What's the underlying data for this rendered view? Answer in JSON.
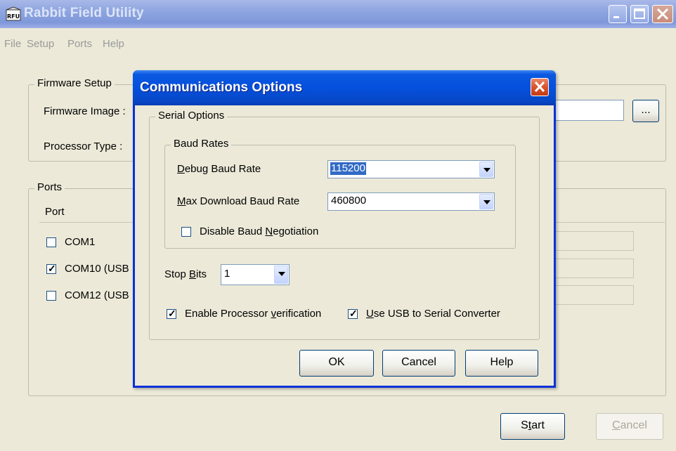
{
  "main": {
    "title": "Rabbit Field Utility",
    "menu": [
      "File",
      "Setup",
      "Ports",
      "Help"
    ],
    "firmware_group": "Firmware Setup",
    "firmware_image_label": "Firmware Image :",
    "processor_type_label": "Processor Type :",
    "browse_label": "...",
    "ports_group": "Ports",
    "port_column": "Port",
    "ports": [
      {
        "label": "COM1",
        "checked": false
      },
      {
        "label": "COM10 (USB",
        "checked": true
      },
      {
        "label": "COM12 (USB",
        "checked": false
      }
    ],
    "start_label": "Start",
    "cancel_label": "Cancel"
  },
  "dialog": {
    "title": "Communications Options",
    "serial_group": "Serial Options",
    "baud_group": "Baud Rates",
    "debug_baud_label": "Debug Baud Rate",
    "debug_baud_value": "115200",
    "max_baud_label": "Max Download Baud Rate",
    "max_baud_value": "460800",
    "disable_negotiation_label": "Disable Baud Negotiation",
    "stop_bits_label": "Stop Bits",
    "stop_bits_value": "1",
    "processor_verification_label": "Enable Processor verification",
    "usb_converter_label": "Use USB to Serial Converter",
    "ok_label": "OK",
    "cancel_label": "Cancel",
    "help_label": "Help"
  },
  "colors": {
    "titlebar_active": "#0550dd",
    "titlebar_inactive": "#8ea5e0",
    "window_bg": "#ece9d8",
    "selection": "#316ac5",
    "close_button": "#d9542b"
  }
}
